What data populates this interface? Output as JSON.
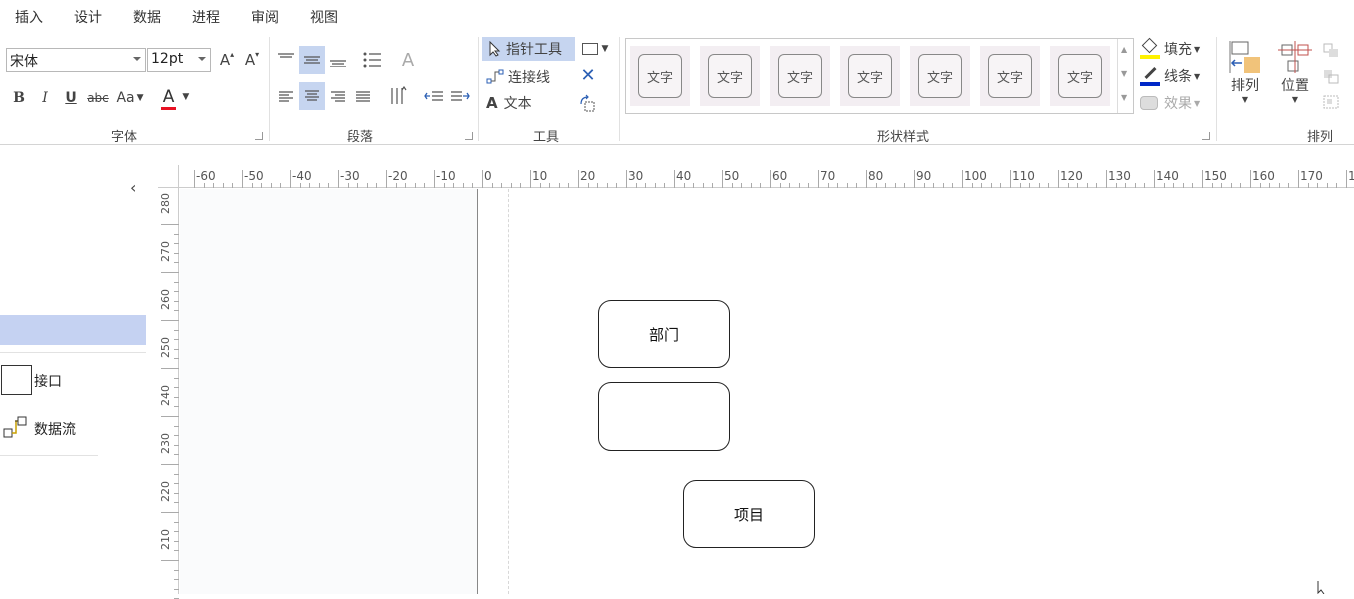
{
  "menu": [
    "插入",
    "设计",
    "数据",
    "进程",
    "审阅",
    "视图"
  ],
  "font": {
    "family": "宋体",
    "size": "12pt",
    "grow": "A",
    "shrink": "A",
    "bold": "B",
    "italic": "I",
    "underline": "U",
    "strike": "abc",
    "case": "Aa",
    "color_letter": "A",
    "font_color": "#e81123",
    "label": "字体"
  },
  "paragraph": {
    "label": "段落"
  },
  "tools": {
    "pointer": "指针工具",
    "connector": "连接线",
    "text": "文本",
    "text_glyph": "A",
    "label": "工具"
  },
  "shape_styles": {
    "items": [
      "文字",
      "文字",
      "文字",
      "文字",
      "文字",
      "文字",
      "文字"
    ],
    "fill": "填充",
    "line": "线条",
    "effects": "效果",
    "label": "形状样式"
  },
  "arrange": {
    "arrange": "排列",
    "position": "位置",
    "label": "排列"
  },
  "ruler": {
    "top": [
      "-60",
      "-50",
      "-40",
      "-30",
      "-20",
      "-10",
      "0",
      "10",
      "20",
      "30",
      "40",
      "50",
      "60",
      "70",
      "80",
      "90",
      "100",
      "110",
      "120",
      "130",
      "140",
      "150",
      "160",
      "170",
      "18"
    ],
    "left": [
      "280",
      "270",
      "260",
      "250",
      "240",
      "230",
      "220",
      "210"
    ]
  },
  "panel": {
    "collapse": "‹",
    "items": [
      {
        "label": "接口",
        "icon": "interface-shape-icon"
      },
      {
        "label": "数据流",
        "icon": "dataflow-shape-icon"
      }
    ]
  },
  "shapes": [
    "部门",
    "",
    "项目"
  ]
}
